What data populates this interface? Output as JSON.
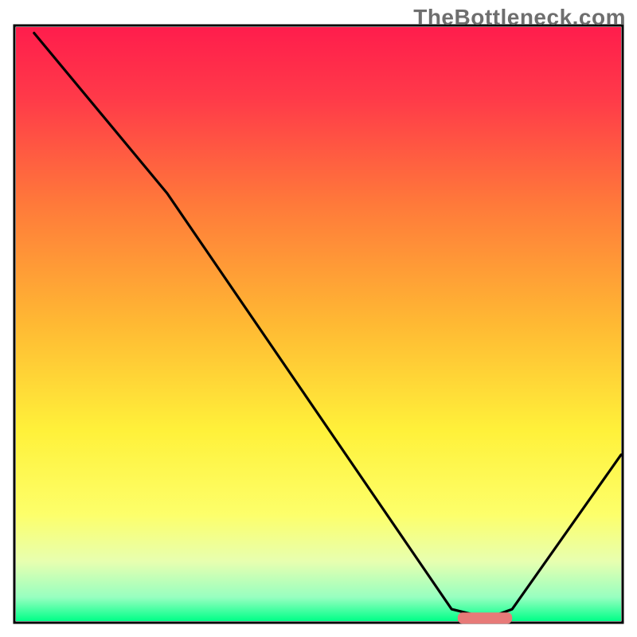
{
  "watermark": "TheBottleneck.com",
  "chart_data": {
    "type": "line",
    "title": "",
    "xlabel": "",
    "ylabel": "",
    "xlim": [
      0,
      100
    ],
    "ylim": [
      0,
      100
    ],
    "series": [
      {
        "name": "bottleneck-curve",
        "x": [
          3,
          25,
          72,
          78,
          82,
          100
        ],
        "y": [
          99,
          72,
          2,
          0.5,
          2,
          28
        ]
      }
    ],
    "optimal_marker": {
      "x_start": 73,
      "x_end": 82,
      "y": 0.5
    },
    "background_gradient": {
      "stops": [
        {
          "pct": 0,
          "color": "#ff1d4c"
        },
        {
          "pct": 12,
          "color": "#ff3a49"
        },
        {
          "pct": 30,
          "color": "#ff7a3a"
        },
        {
          "pct": 50,
          "color": "#ffb933"
        },
        {
          "pct": 68,
          "color": "#fff13a"
        },
        {
          "pct": 82,
          "color": "#fdff6a"
        },
        {
          "pct": 90,
          "color": "#e7ffb0"
        },
        {
          "pct": 96,
          "color": "#97ffc0"
        },
        {
          "pct": 100,
          "color": "#00ff88"
        }
      ]
    },
    "axes_visible": false,
    "grid": false,
    "legend": false
  },
  "icons": {
    "none": ""
  }
}
